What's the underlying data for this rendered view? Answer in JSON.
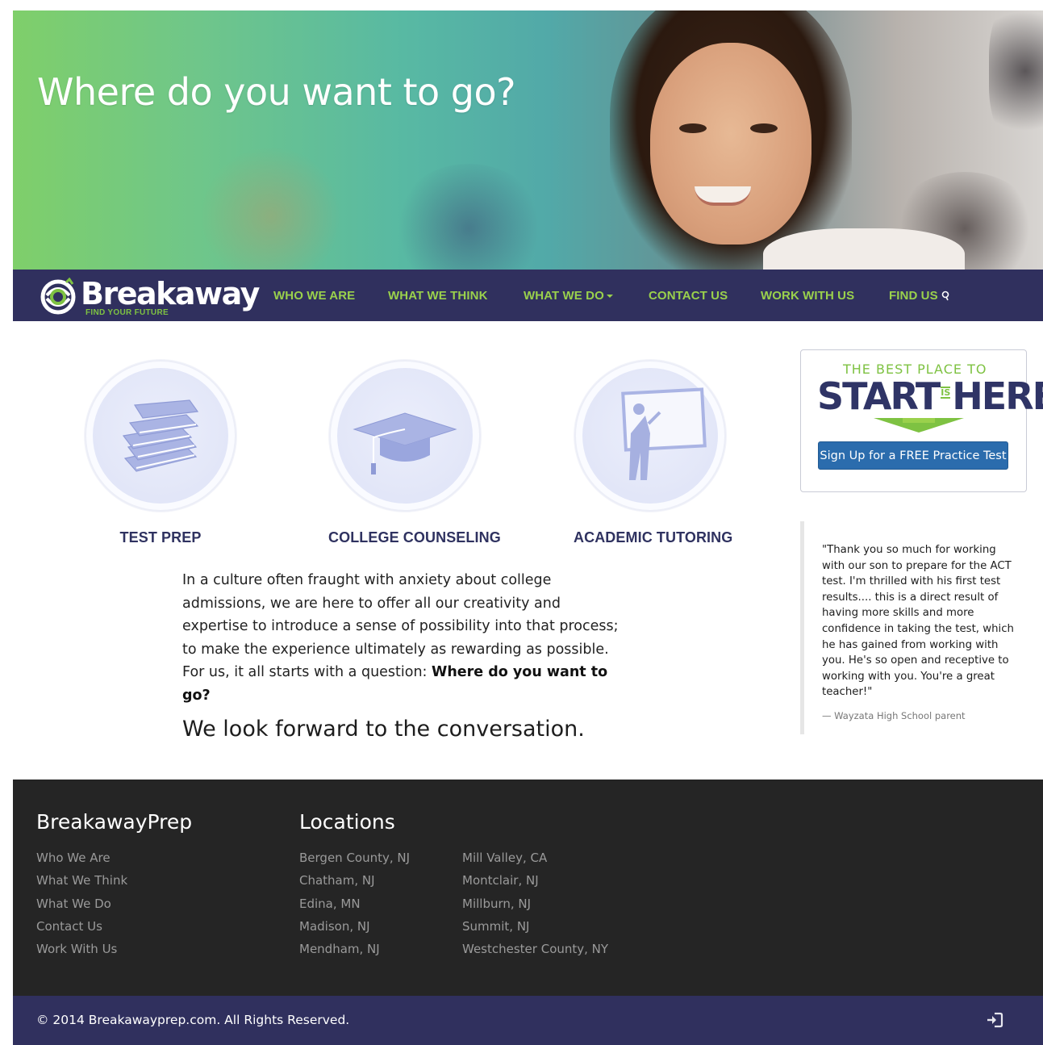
{
  "hero": {
    "title": "Where do you want to go?"
  },
  "navbar": {
    "logo_text": "Breakaway",
    "logo_tagline": "FIND YOUR FUTURE",
    "items": [
      {
        "label": "WHO WE ARE"
      },
      {
        "label": "WHAT WE THINK"
      },
      {
        "label": "WHAT WE DO"
      },
      {
        "label": "CONTACT US"
      },
      {
        "label": "WORK WITH US"
      },
      {
        "label": "FIND US"
      }
    ]
  },
  "services": [
    {
      "label": "TEST PREP",
      "icon": "books-icon"
    },
    {
      "label": "COLLEGE COUNSELING",
      "icon": "graduation-cap-icon"
    },
    {
      "label": "ACADEMIC TUTORING",
      "icon": "teacher-whiteboard-icon"
    }
  ],
  "intro": {
    "text": "In a culture often fraught with anxiety about college admissions, we are here to offer all our creativity and expertise to introduce a sense of possibility into that process; to make the experience ultimately as rewarding as possible. For us, it all starts with a question: ",
    "emphasis": "Where do you want to go?",
    "tagline": "We look forward to the conversation."
  },
  "promo": {
    "line1": "THE BEST PLACE TO",
    "big_start": "START",
    "is": "IS",
    "big_here": "HERE",
    "button_label": "Sign Up for a FREE Practice Test"
  },
  "testimonial": {
    "text": "\"Thank you so much for working with our son to prepare for the ACT test. I'm thrilled with his first test results.... this is a direct result of having more skills and more confidence in taking the test, which he has gained from working with you. He's so open and receptive to working with you. You're a great teacher!\"",
    "source": "— Wayzata High School parent"
  },
  "footer": {
    "brand_heading": "BreakawayPrep",
    "brand_links": [
      "Who We Are",
      "What We Think",
      "What We Do",
      "Contact Us",
      "Work With Us"
    ],
    "locations_heading": "Locations",
    "locations_col1": [
      "Bergen County, NJ",
      "Chatham, NJ",
      "Edina, MN",
      "Madison, NJ",
      "Mendham, NJ"
    ],
    "locations_col2": [
      "Mill Valley, CA",
      "Montclair, NJ",
      "Millburn, NJ",
      "Summit, NJ",
      "Westchester County, NY"
    ],
    "copyright": "© 2014 Breakawayprep.com. All Rights Reserved."
  },
  "colors": {
    "nav_bg": "#30305e",
    "nav_link": "#9ad14c",
    "brand_green": "#7ec242",
    "button_blue": "#2b6cad",
    "footer_bg": "#252525"
  }
}
